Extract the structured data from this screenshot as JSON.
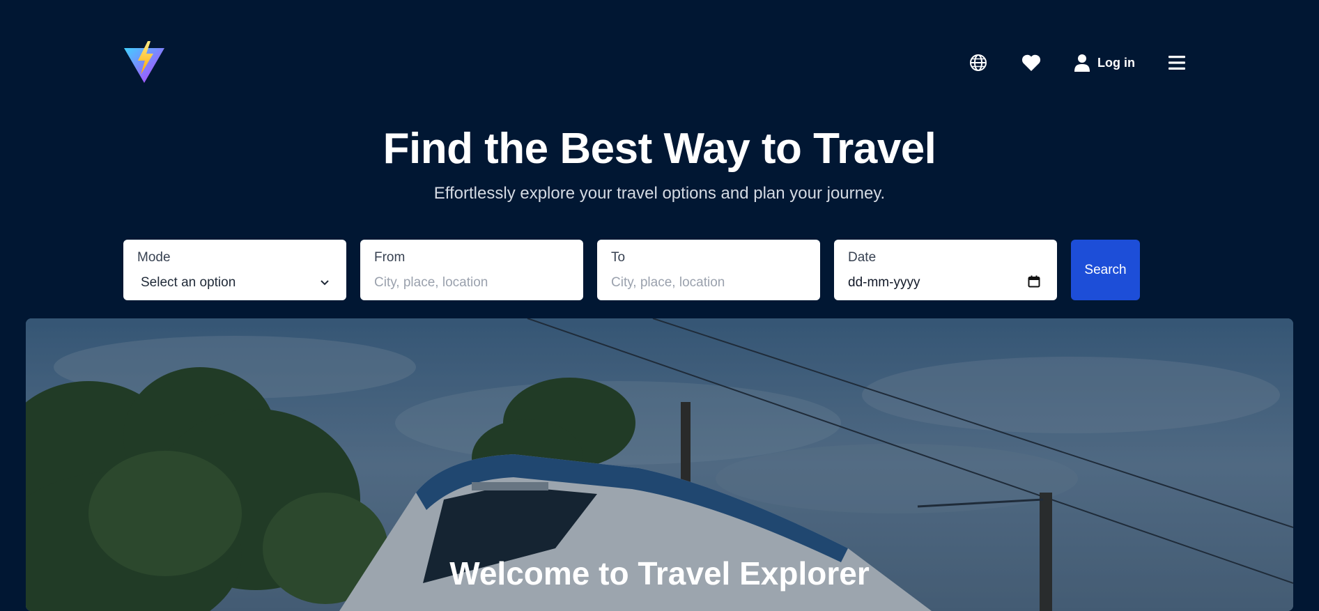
{
  "brand": {
    "logo_icon": "lightning-triangle-logo"
  },
  "nav": {
    "language_icon": "globe-icon",
    "favorites_icon": "heart-icon",
    "user_icon": "user-icon",
    "login_label": "Log in",
    "menu_icon": "hamburger-menu-icon"
  },
  "hero": {
    "title": "Find the Best Way to Travel",
    "subtitle": "Effortlessly explore your travel options and plan your journey."
  },
  "search": {
    "mode": {
      "label": "Mode",
      "value": "Select an option"
    },
    "from": {
      "label": "From",
      "placeholder": "City, place, location"
    },
    "to": {
      "label": "To",
      "placeholder": "City, place, location"
    },
    "date": {
      "label": "Date",
      "placeholder": "dd-mm-yyyy"
    },
    "button_label": "Search"
  },
  "banner": {
    "title": "Welcome to Travel Explorer",
    "image": "train-photo"
  },
  "colors": {
    "background": "#011733",
    "accent": "#1d4ed8",
    "text_primary": "#ffffff"
  }
}
